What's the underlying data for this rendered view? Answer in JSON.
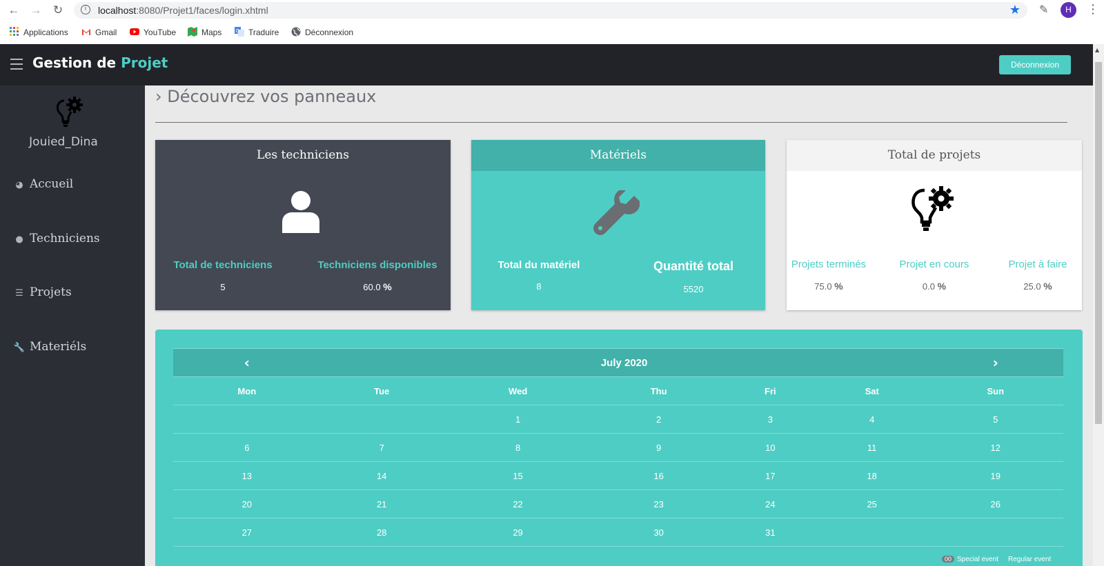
{
  "browser": {
    "url_host": "localhost",
    "url_path": ":8080/Projet1/faces/login.xhtml",
    "profile_initial": "H",
    "back_icon": "arrow-left-icon",
    "forward_icon": "arrow-right-icon",
    "reload_icon": "reload-icon"
  },
  "bookmarks": [
    {
      "label": "Applications",
      "icon": "apps-grid-icon"
    },
    {
      "label": "Gmail",
      "icon": "gmail-icon"
    },
    {
      "label": "YouTube",
      "icon": "youtube-icon"
    },
    {
      "label": "Maps",
      "icon": "maps-icon"
    },
    {
      "label": "Traduire",
      "icon": "translate-icon"
    },
    {
      "label": "Déconnexion",
      "icon": "globe-icon"
    }
  ],
  "header": {
    "title_main": "Gestion de ",
    "title_accent": "Projet",
    "logout_label": "Déconnexion",
    "accent_color": "#4ecdc4"
  },
  "sidebar": {
    "username": "Jouied_Dina",
    "items": [
      {
        "label": "Accueil",
        "icon": "dashboard-icon"
      },
      {
        "label": "Techniciens",
        "icon": "users-icon"
      },
      {
        "label": "Projets",
        "icon": "list-icon"
      },
      {
        "label": "Materiéls",
        "icon": "wrench-icon"
      }
    ]
  },
  "main": {
    "heading": "Découvrez vos panneaux",
    "panels": {
      "technicians": {
        "title": "Les techniciens",
        "total_label": "Total de techniciens",
        "total_value": "5",
        "available_label": "Techniciens disponibles",
        "available_value": "60.0",
        "pct": "%"
      },
      "materials": {
        "title": "Matériels",
        "total_label": "Total du matériel",
        "total_value": "8",
        "qty_label": "Quantité total",
        "qty_value": "5520"
      },
      "projects": {
        "title": "Total de projets",
        "done_label": "Projets terminés",
        "done_value": "75.0",
        "inprogress_label": "Projet en cours",
        "inprogress_value": "0.0",
        "todo_label": "Projet à faire",
        "todo_value": "25.0",
        "pct": "%"
      }
    },
    "calendar": {
      "month": "July 2020",
      "weekdays": [
        "Mon",
        "Tue",
        "Wed",
        "Thu",
        "Fri",
        "Sat",
        "Sun"
      ],
      "weeks": [
        [
          "",
          "",
          "1",
          "2",
          "3",
          "4",
          "5"
        ],
        [
          "6",
          "7",
          "8",
          "9",
          "10",
          "11",
          "12"
        ],
        [
          "13",
          "14",
          "15",
          "16",
          "17",
          "18",
          "19"
        ],
        [
          "20",
          "21",
          "22",
          "23",
          "24",
          "25",
          "26"
        ],
        [
          "27",
          "28",
          "29",
          "30",
          "31",
          "",
          ""
        ]
      ],
      "legend_chip": "00",
      "legend_special": "Special event",
      "legend_regular": "Regular event"
    }
  }
}
